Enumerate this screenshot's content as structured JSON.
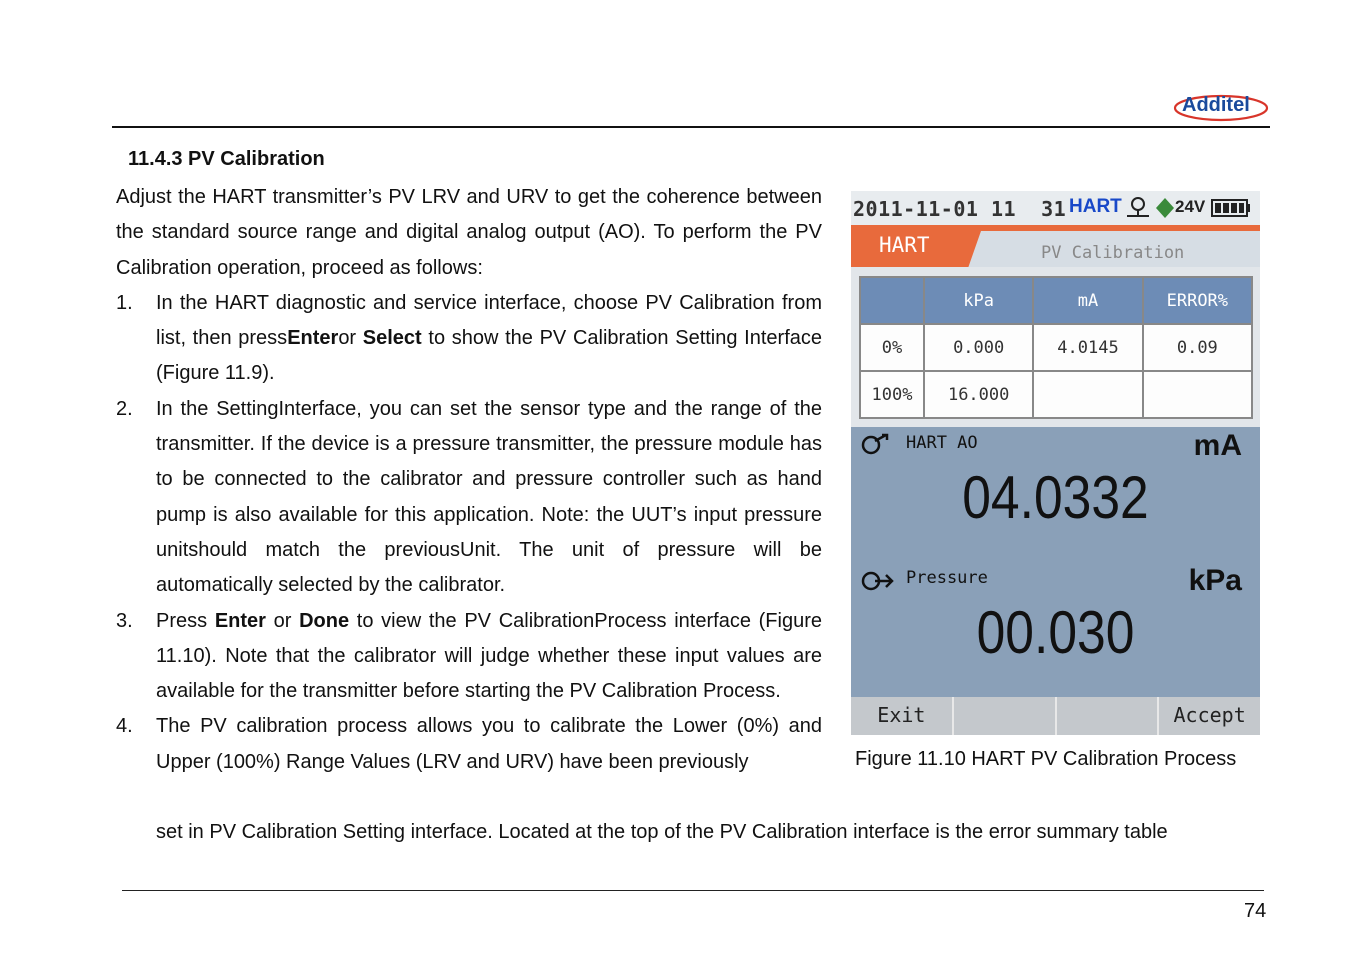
{
  "header": {
    "logo_text": "Additel"
  },
  "section": {
    "title": "11.4.3 PV Calibration"
  },
  "intro": "Adjust the HART transmitter’s PV LRV and URV to get the coherence between the standard source range and digital analog output (AO). To perform the PV Calibration operation, proceed as follows:",
  "steps": [
    {
      "num": "1.",
      "t1": "In the HART diagnostic and service interface, choose PV Calibration from list, then press",
      "b1": "Enter",
      "t2": "or ",
      "b2": "Select",
      "t3": " to show the PV Calibration Setting Interface (Figure 11.9)."
    },
    {
      "num": "2.",
      "text": "In the SettingInterface, you can set the sensor type and the range of the transmitter. If the device is a pressure transmitter, the pressure module has to be connected to the calibrator and pressure controller such as hand pump is also available for this application. Note: the UUT’s input pressure unitshould match the previousUnit. The unit of pressure will be automatically selected by the calibrator."
    },
    {
      "num": "3.",
      "t1": "Press ",
      "b1": "Enter",
      "t2": " or ",
      "b2": "Done",
      "t3": " to view the PV CalibrationProcess interface (Figure 11.10). Note that the calibrator will judge whether these input values are available for the transmitter before starting the PV Calibration Process."
    },
    {
      "num": "4.",
      "text": "The PV calibration process allows you to calibrate the Lower (0%) and Upper (100%) Range Values (LRV and URV) have been previously"
    }
  ],
  "continuation": "set in PV Calibration Setting interface. Located at the top of the PV Calibration interface is the error summary table",
  "figure": {
    "caption": "Figure 11.10 HART PV Calibration Process",
    "screen": {
      "status": {
        "datetime": "2011-11-01 11  31",
        "hart": "HART",
        "voltage": "24V"
      },
      "tab_left": "HART",
      "tab_right": "PV Calibration",
      "table": {
        "headers": [
          "",
          "kPa",
          "mA",
          "ERROR%"
        ],
        "rows": [
          [
            "0%",
            "0.000",
            "4.0145",
            "0.09"
          ],
          [
            "100%",
            "16.000",
            "",
            ""
          ]
        ]
      },
      "ao_panel": {
        "title": "HART AO",
        "unit": "mA",
        "value": "04.0332"
      },
      "pressure_panel": {
        "title": "Pressure",
        "unit": "kPa",
        "value": "00.030"
      },
      "softkeys": [
        "Exit",
        "",
        "",
        "Accept"
      ]
    }
  },
  "footer": {
    "page_number": "74"
  },
  "colors": {
    "orange_band": "#e86a3c",
    "table_header": "#6d8cb6",
    "panel": "#8aa0b8",
    "hart_blue": "#1848c8",
    "logo_blue": "#1a4a9c",
    "logo_red": "#d8352a"
  }
}
